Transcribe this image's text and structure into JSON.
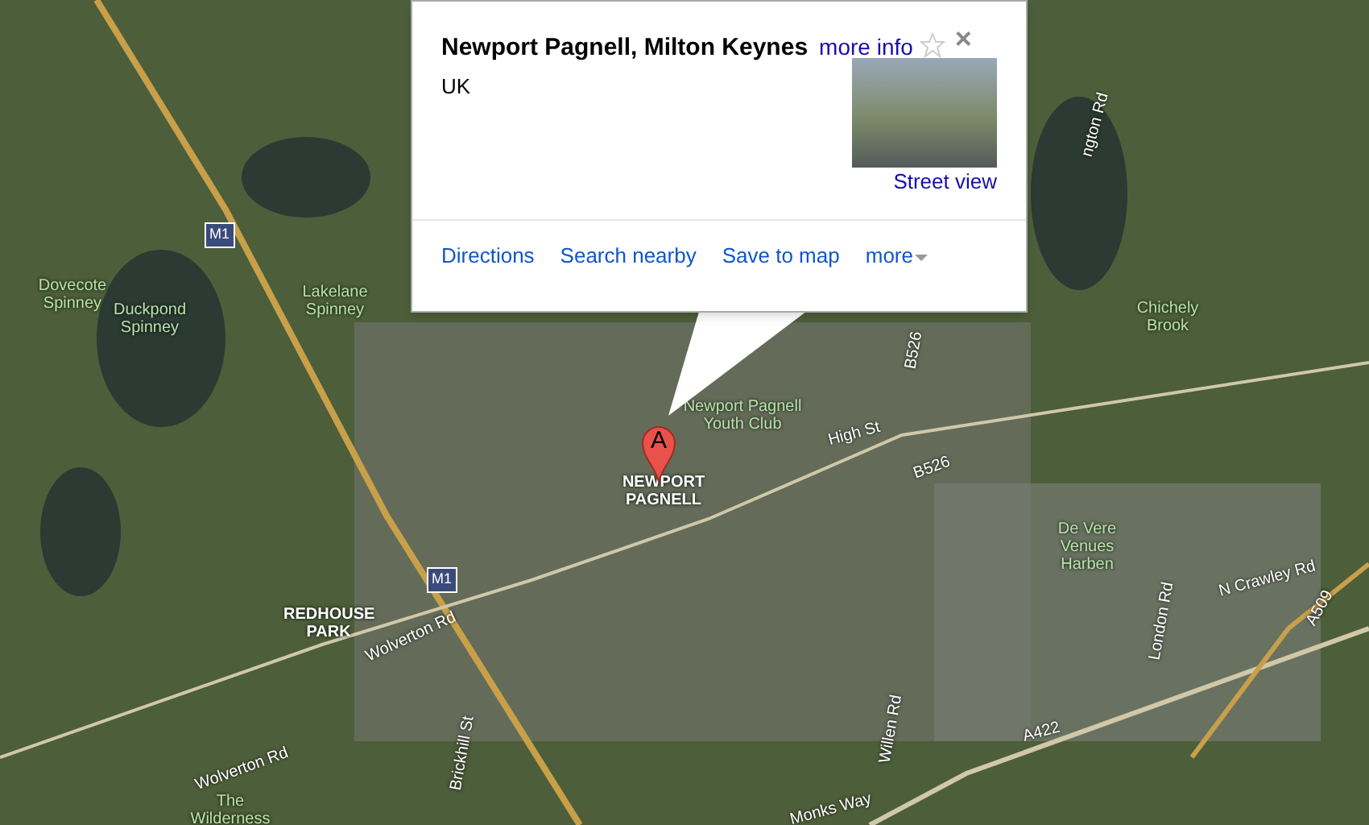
{
  "info_window": {
    "title": "Newport Pagnell, Milton Keynes",
    "more_info": "more info",
    "starred": false,
    "close": "×",
    "address": "UK",
    "street_view": "Street view",
    "actions": [
      "Directions",
      "Search nearby",
      "Save to map"
    ],
    "more": "more"
  },
  "marker": {
    "label": "A"
  },
  "map_labels": [
    {
      "kind": "shield",
      "text": "M1"
    },
    {
      "kind": "shield",
      "text": "M1"
    },
    {
      "kind": "place",
      "text": "Dovecote Spinney"
    },
    {
      "kind": "place",
      "text": "Duckpond Spinney"
    },
    {
      "kind": "place",
      "text": "Lakelane Spinney"
    },
    {
      "kind": "place",
      "text": "Newport Pagnell Youth Club"
    },
    {
      "kind": "town",
      "text": "NEWPORT PAGNELL"
    },
    {
      "kind": "town",
      "text": "REDHOUSE PARK"
    },
    {
      "kind": "place",
      "text": "Chichely Brook"
    },
    {
      "kind": "place",
      "text": "De Vere Venues Harben"
    },
    {
      "kind": "road",
      "text": "ngton Rd"
    },
    {
      "kind": "road",
      "text": "B526"
    },
    {
      "kind": "road",
      "text": "High St"
    },
    {
      "kind": "road",
      "text": "B526"
    },
    {
      "kind": "road",
      "text": "N Crawley Rd"
    },
    {
      "kind": "road",
      "text": "A509"
    },
    {
      "kind": "road",
      "text": "London Rd"
    },
    {
      "kind": "road",
      "text": "Wolverton Rd"
    },
    {
      "kind": "road",
      "text": "Wolverton Rd"
    },
    {
      "kind": "road",
      "text": "Brickhill St"
    },
    {
      "kind": "road",
      "text": "Willen Rd"
    },
    {
      "kind": "road",
      "text": "A422"
    },
    {
      "kind": "road",
      "text": "Monks Way"
    },
    {
      "kind": "place",
      "text": "The Wilderness"
    }
  ]
}
